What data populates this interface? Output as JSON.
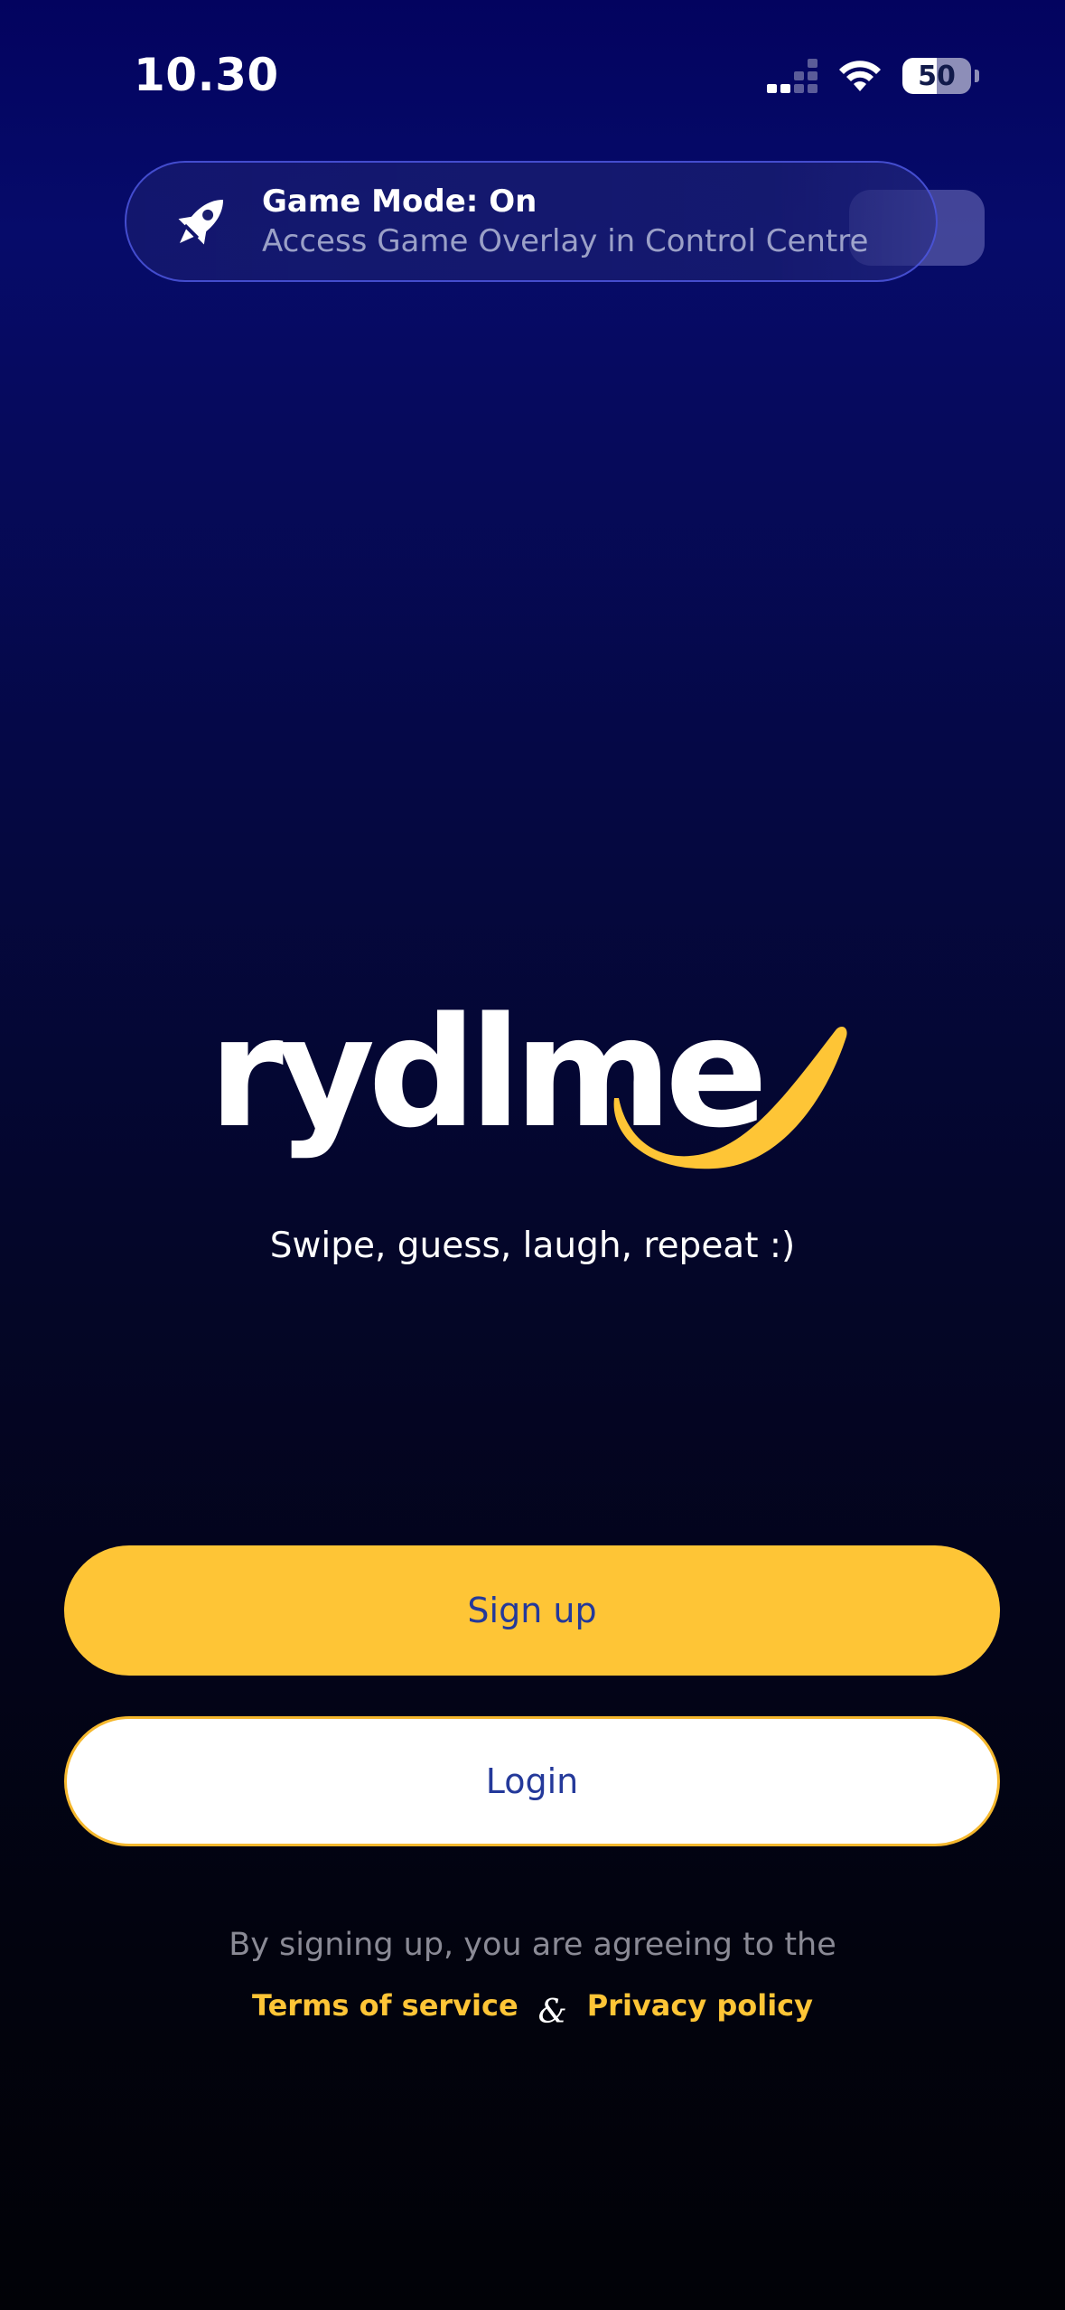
{
  "status_bar": {
    "time": "10.30",
    "battery_level": "50",
    "battery_fraction": 0.5,
    "icons": [
      "cellular-signal-icon",
      "wifi-icon",
      "battery-icon"
    ]
  },
  "notification": {
    "title": "Game Mode: On",
    "subtitle": "Access Game Overlay in Control Centre",
    "icon": "rocket-icon"
  },
  "brand": {
    "logo_text": "rydlme",
    "tagline": "Swipe, guess, laugh, repeat :)"
  },
  "actions": {
    "signup_label": "Sign up",
    "login_label": "Login"
  },
  "legal": {
    "notice": "By signing up, you are agreeing to the",
    "terms_label": "Terms of service",
    "separator": "&",
    "privacy_label": "Privacy policy"
  },
  "colors": {
    "accent_yellow": "#fec536",
    "button_text_blue": "#24399a",
    "background_top": "#03035f",
    "background_bottom": "#010207"
  }
}
